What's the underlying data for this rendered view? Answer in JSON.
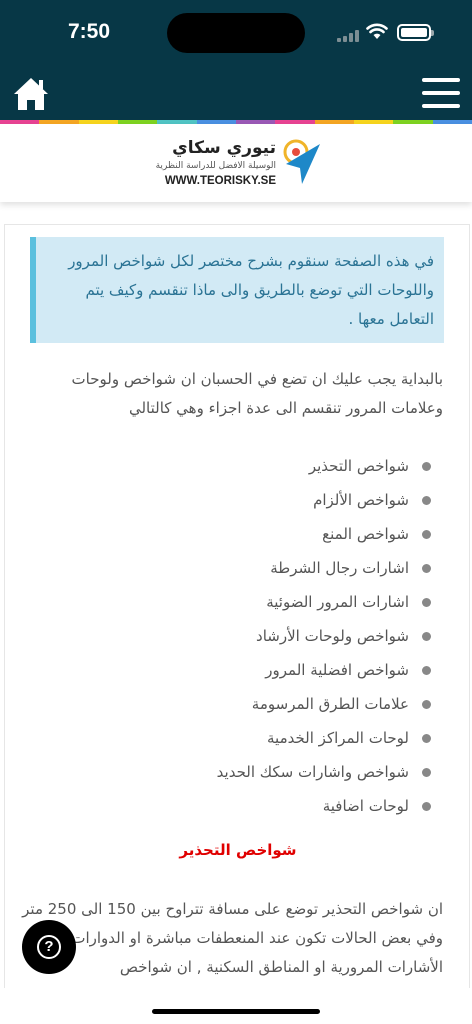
{
  "status": {
    "time": "7:50"
  },
  "colors": {
    "header": "#073746",
    "rainbow": [
      "#e84393",
      "#f5a623",
      "#f7d51d",
      "#7ed321",
      "#50c4c4",
      "#4a90e2",
      "#9b59b6",
      "#e84393",
      "#f5a623",
      "#f7d51d",
      "#7ed321",
      "#4a90e2"
    ]
  },
  "header": {
    "home_icon": "home-icon",
    "menu_icon": "hamburger-menu-icon"
  },
  "logo": {
    "title": "تيوري سكاي",
    "tagline": "الوسيلة الافضل للدراسة النظرية",
    "url": "WWW.TEORISKY.SE"
  },
  "info_box": "في هذه الصفحة سنقوم بشرح مختصر لكل شواخص المرور واللوحات التي توضع بالطريق والى ماذا تنقسم وكيف يتم التعامل معها .",
  "intro": "بالبداية يجب عليك ان تضع في الحسبان ان شواخص ولوحات وعلامات المرور تنقسم الى عدة اجزاء وهي كالتالي",
  "categories": [
    "شواخص التحذير",
    "شواخص الألزام",
    "شواخص المنع",
    "اشارات رجال الشرطة",
    "اشارات المرور الضوئية",
    "شواخص ولوحات الأرشاد",
    "شواخص افضلية المرور",
    "علامات الطرق المرسومة",
    "لوحات المراكز الخدمية",
    "شواخص واشارات سكك الحديد",
    "لوحات اضافية"
  ],
  "section_title": "شواخص التحذير",
  "section_paragraph": "ان شواخص التحذير توضع على مسافة تتراوح بين 150 الى 250 متر وفي بعض الحالات تكون عند المنعطفات مباشرة او الدوارات او الأشارات المرورية او المناطق السكنية , ان شواخص",
  "help_button": {
    "label": "?"
  }
}
